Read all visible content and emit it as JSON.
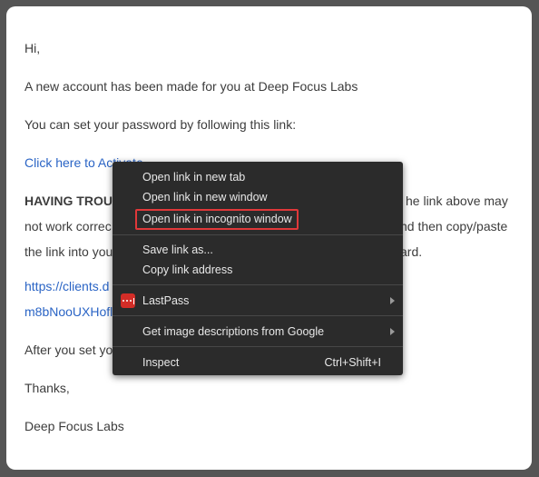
{
  "email": {
    "greeting": "Hi,",
    "line1": "A new account has been made for you at Deep Focus Labs",
    "line2": "You can set your password by following this link:",
    "activate_link": "Click here to Activate",
    "trouble_bold": "HAVING TROUB",
    "trouble_right1": "he link above may",
    "trouble_line2_left": "not work correc",
    "trouble_line2_right": "nd then copy/paste",
    "trouble_line3_left": "the link into you",
    "trouble_line3_right": "ard.",
    "url_part1": "https://clients.d",
    "url_part2": "m8bNooUXHofl",
    "after_set": "After you set yo",
    "thanks": "Thanks,",
    "signature": "Deep Focus Labs"
  },
  "context_menu": {
    "open_new_tab": "Open link in new tab",
    "open_new_window": "Open link in new window",
    "open_incognito": "Open link in incognito window",
    "save_link_as": "Save link as...",
    "copy_link_address": "Copy link address",
    "lastpass": "LastPass",
    "image_descriptions": "Get image descriptions from Google",
    "inspect": "Inspect",
    "inspect_shortcut": "Ctrl+Shift+I"
  },
  "colors": {
    "link": "#2a64c5",
    "menu_bg": "#2b2b2b",
    "highlight": "#e0383a",
    "lastpass": "#d32d27"
  }
}
